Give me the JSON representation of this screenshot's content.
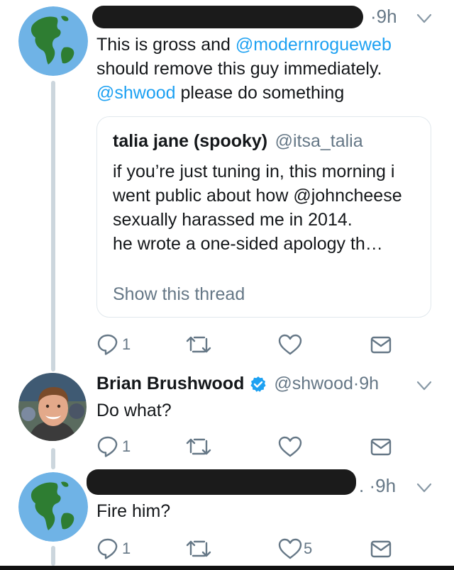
{
  "tweets": [
    {
      "time": "9h",
      "text_parts": [
        "This is gross and ",
        "@modernrogueweb",
        " should remove this guy immediately. ",
        "@shwood",
        " please do something"
      ],
      "quote": {
        "name": "talia jane (spooky)",
        "handle": "@itsa_talia",
        "text": "if you’re just tuning in, this morning i went public about how @johncheese sexually harassed me in 2014.\nhe wrote a one-sided apology th…",
        "show_thread": "Show this thread"
      },
      "reply_count": "1",
      "like_count": ""
    },
    {
      "name": "Brian Brushwood",
      "verified": true,
      "handle": "@shwood",
      "time": "9h",
      "text": "Do what?",
      "reply_count": "1",
      "like_count": ""
    },
    {
      "time": "9h",
      "text": "Fire him?",
      "reply_count": "1",
      "like_count": "5"
    }
  ],
  "separator": "·",
  "colors": {
    "link": "#1da1f2",
    "meta": "#657786",
    "thread_line": "#ccd6dd",
    "verified": "#1da1f2"
  },
  "icons": [
    "globe-avatar-icon",
    "reply-icon",
    "retweet-icon",
    "like-icon",
    "message-icon",
    "chevron-down-icon",
    "verified-badge-icon"
  ]
}
